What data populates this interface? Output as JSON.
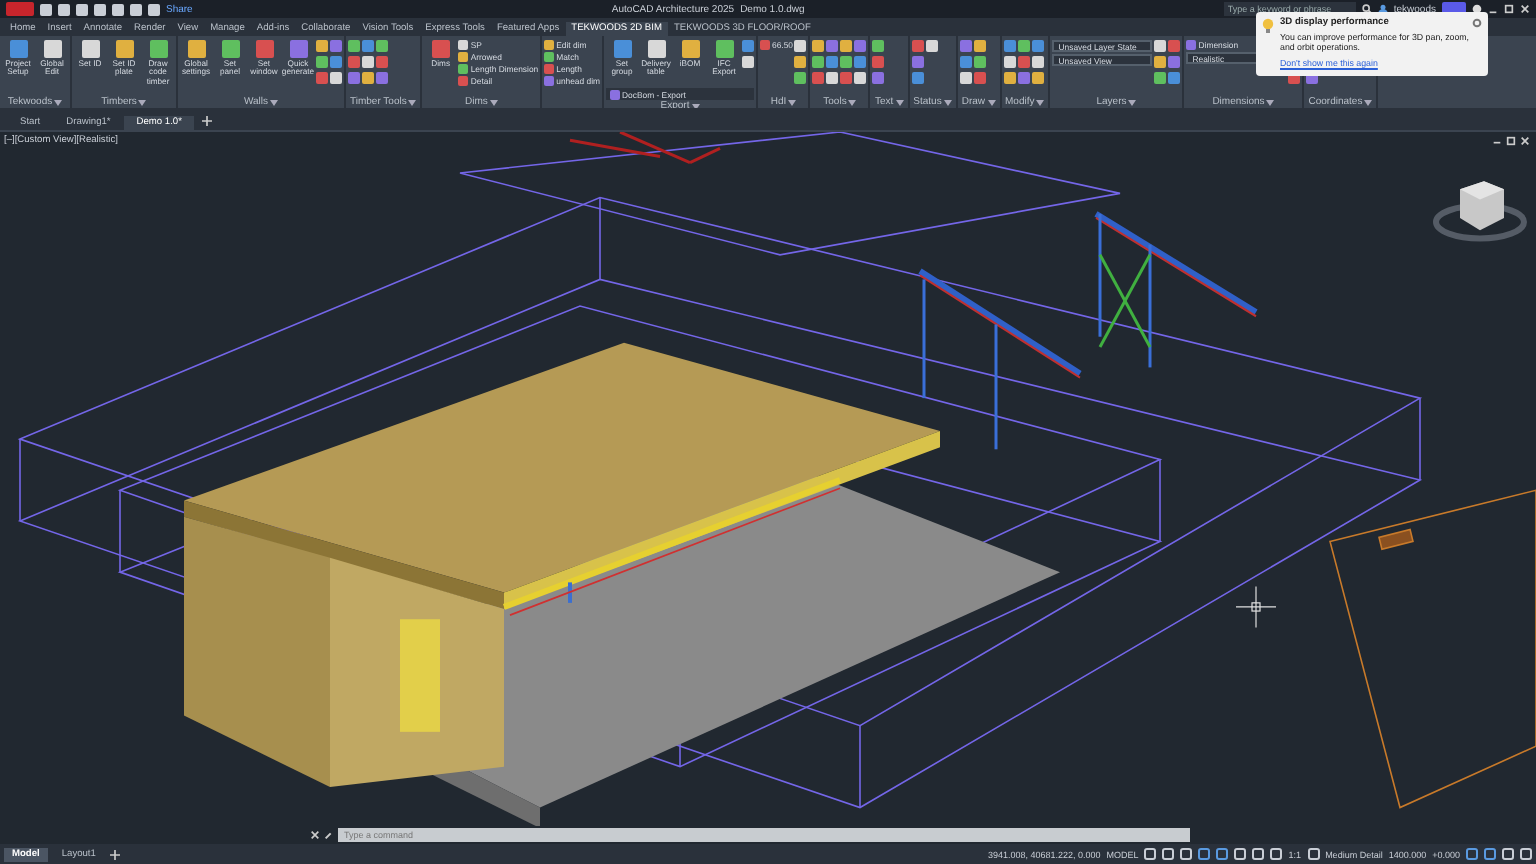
{
  "title_bar": {
    "share": "Share",
    "app_title": "AutoCAD Architecture 2025",
    "file_title": "Demo 1.0.dwg",
    "search": {
      "placeholder": "Type a keyword or phrase"
    },
    "user": "tekwoods"
  },
  "ribbon_tabs": [
    {
      "label": "Home",
      "selected": false
    },
    {
      "label": "Insert",
      "selected": false
    },
    {
      "label": "Annotate",
      "selected": false
    },
    {
      "label": "Render",
      "selected": false
    },
    {
      "label": "View",
      "selected": false
    },
    {
      "label": "Manage",
      "selected": false
    },
    {
      "label": "Add-ins",
      "selected": false
    },
    {
      "label": "Collaborate",
      "selected": false
    },
    {
      "label": "Vision Tools",
      "selected": false
    },
    {
      "label": "Express Tools",
      "selected": false
    },
    {
      "label": "Featured Apps",
      "selected": false
    },
    {
      "label": "TEKWOODS 2D BIM",
      "selected": true
    },
    {
      "label": "TEKWOODS 3D FLOOR/ROOF",
      "selected": false
    }
  ],
  "ribbon_panels": [
    {
      "title": "Tekwoods",
      "tools": [
        {
          "kind": "large",
          "label": "Project Setup"
        },
        {
          "kind": "large",
          "label": "Global Edit"
        }
      ]
    },
    {
      "title": "Timbers",
      "tools": [
        {
          "kind": "large",
          "label": "Set ID"
        },
        {
          "kind": "large",
          "label": "Set ID plate"
        },
        {
          "kind": "large",
          "label": "Draw code timber"
        }
      ]
    },
    {
      "title": "Walls",
      "tools": [
        {
          "kind": "large",
          "label": "Global settings"
        },
        {
          "kind": "large",
          "label": "Set panel"
        },
        {
          "kind": "large",
          "label": "Set window"
        },
        {
          "kind": "large",
          "label": "Quick generate"
        }
      ]
    },
    {
      "title": "Timber Tools"
    },
    {
      "title": "Dims",
      "tools": [
        {
          "kind": "large",
          "label": "Dims"
        },
        {
          "kind": "small",
          "label": "SP"
        },
        {
          "kind": "small",
          "label": "Arrowed"
        },
        {
          "kind": "small",
          "label": "Length Dimension"
        },
        {
          "kind": "small",
          "label": "Detail"
        }
      ]
    },
    {
      "tools": [
        {
          "kind": "small",
          "label": "Edit dim"
        },
        {
          "kind": "small",
          "label": "Match"
        },
        {
          "kind": "small",
          "label": "Length"
        },
        {
          "kind": "small",
          "label": "unhead dim"
        }
      ]
    },
    {
      "title": "Export",
      "tools": [
        {
          "kind": "large",
          "label": "Set group"
        },
        {
          "kind": "large",
          "label": "Delivery table"
        },
        {
          "kind": "large",
          "label": "iBOM"
        },
        {
          "kind": "large",
          "label": "IFC Export"
        },
        {
          "kind": "wide",
          "label": "DocBom - Export"
        }
      ]
    },
    {
      "title": "HdI",
      "tools": [
        {
          "kind": "small",
          "label": "66.50"
        }
      ]
    },
    {
      "title": "Tools"
    },
    {
      "title": "Text"
    },
    {
      "title": "Status"
    },
    {
      "title": "Draw"
    },
    {
      "title": "Modify"
    },
    {
      "title": "Layers",
      "tools": [
        {
          "kind": "dropdown",
          "label": "Unsaved Layer State"
        },
        {
          "kind": "dropdown",
          "label": "Unsaved View"
        }
      ]
    },
    {
      "title": "Dimensions",
      "tools": [
        {
          "kind": "small",
          "label": "Dimension"
        },
        {
          "kind": "dropdown",
          "label": "Realistic"
        }
      ]
    },
    {
      "title": "Coordinates"
    }
  ],
  "file_tabs": [
    {
      "label": "Start",
      "selected": false
    },
    {
      "label": "Drawing1*",
      "selected": false
    },
    {
      "label": "Demo 1.0*",
      "selected": true
    }
  ],
  "viewport": {
    "label": "[–][Custom View][Realistic]"
  },
  "notification": {
    "title": "3D display performance",
    "body": "You can improve performance for 3D pan, zoom, and orbit operations.",
    "link": "Don't show me this again"
  },
  "command_line": {
    "placeholder": "Type a command"
  },
  "layout_tabs": [
    {
      "label": "Model",
      "selected": true
    },
    {
      "label": "Layout1",
      "selected": false
    }
  ],
  "status_bar": {
    "coordinates": "3941.008, 40681.222, 0.000",
    "space": "MODEL",
    "scale": "1:1",
    "detail": "Medium Detail",
    "elevation": "1400.000",
    "offset": "+0.000"
  }
}
